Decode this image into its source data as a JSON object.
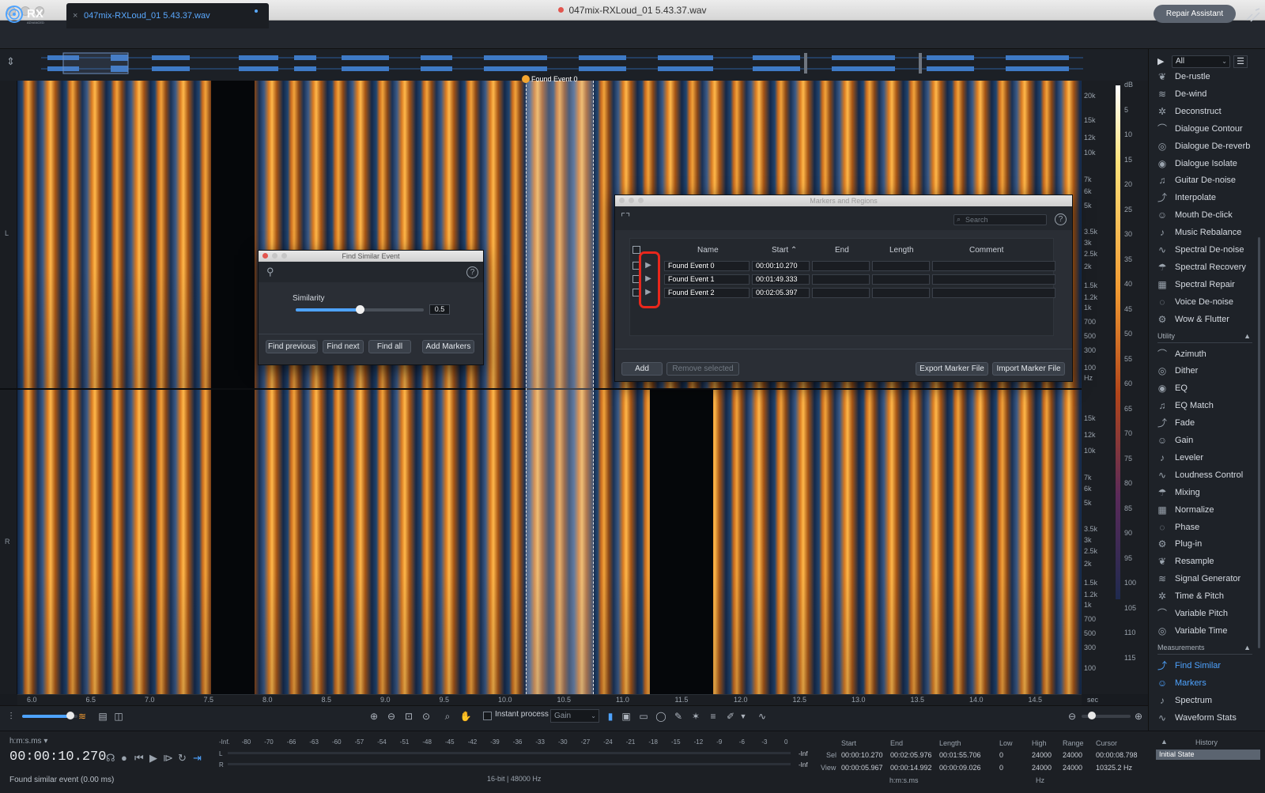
{
  "window": {
    "title": "047mix-RXLoud_01 5.43.37.wav"
  },
  "header": {
    "tab_label": "047mix-RXLoud_01 5.43.37.wav",
    "tab_close": "×",
    "repair_assistant": "Repair Assistant"
  },
  "spectrogram": {
    "marker_label": "Found Event 0",
    "channel_left": "L",
    "channel_right": "R",
    "freq_top": [
      "20k",
      "15k",
      "12k",
      "10k",
      "7k",
      "6k",
      "5k",
      "3.5k",
      "3k",
      "2.5k",
      "2k",
      "1.5k",
      "1.2k",
      "1k",
      "700",
      "500",
      "300",
      "100",
      "Hz"
    ],
    "freq_bot": [
      "20k",
      "15k",
      "12k",
      "10k",
      "7k",
      "6k",
      "5k",
      "3.5k",
      "3k",
      "2.5k",
      "2k",
      "1.5k",
      "1.2k",
      "1k",
      "700",
      "500",
      "300",
      "100"
    ],
    "db_scale": [
      "dB",
      "5",
      "10",
      "15",
      "20",
      "25",
      "30",
      "35",
      "40",
      "45",
      "50",
      "55",
      "60",
      "65",
      "70",
      "75",
      "80",
      "85",
      "90",
      "95",
      "100",
      "105",
      "110",
      "115"
    ],
    "time_ticks": [
      "6.0",
      "6.5",
      "7.0",
      "7.5",
      "8.0",
      "8.5",
      "9.0",
      "9.5",
      "10.0",
      "10.5",
      "11.0",
      "11.5",
      "12.0",
      "12.5",
      "13.0",
      "13.5",
      "14.0",
      "14.5",
      "sec"
    ]
  },
  "find_similar": {
    "title": "Find Similar Event",
    "similarity_label": "Similarity",
    "similarity_value": "0.5",
    "similarity_fraction": 0.5,
    "help": "?",
    "buttons": [
      "Find previous",
      "Find next",
      "Find all",
      "Add Markers"
    ]
  },
  "markers": {
    "title": "Markers and Regions",
    "search_placeholder": "Search",
    "help": "?",
    "columns": [
      "Name",
      "Start",
      "End",
      "Length",
      "Comment"
    ],
    "sort_indicator": "⌃",
    "rows": [
      {
        "name": "Found Event 0",
        "start": "00:00:10.270",
        "end": "",
        "length": "",
        "comment": ""
      },
      {
        "name": "Found Event 1",
        "start": "00:01:49.333",
        "end": "",
        "length": "",
        "comment": ""
      },
      {
        "name": "Found Event 2",
        "start": "00:02:05.397",
        "end": "",
        "length": "",
        "comment": ""
      }
    ],
    "buttons": {
      "add": "Add",
      "remove": "Remove selected",
      "export": "Export Marker File",
      "import": "Import Marker File"
    }
  },
  "sidebar": {
    "filter": "All",
    "repair_modules": [
      "De-rustle",
      "De-wind",
      "Deconstruct",
      "Dialogue Contour",
      "Dialogue De-reverb",
      "Dialogue Isolate",
      "Guitar De-noise",
      "Interpolate",
      "Mouth De-click",
      "Music Rebalance",
      "Spectral De-noise",
      "Spectral Recovery",
      "Spectral Repair",
      "Voice De-noise",
      "Wow & Flutter"
    ],
    "utility_label": "Utility",
    "utility_modules": [
      "Azimuth",
      "Dither",
      "EQ",
      "EQ Match",
      "Fade",
      "Gain",
      "Leveler",
      "Loudness Control",
      "Mixing",
      "Normalize",
      "Phase",
      "Plug-in",
      "Resample",
      "Signal Generator",
      "Time & Pitch",
      "Variable Pitch",
      "Variable Time"
    ],
    "measurements_label": "Measurements",
    "measurement_modules": [
      "Find Similar",
      "Markers",
      "Spectrum",
      "Waveform Stats"
    ],
    "active_modules": [
      "Find Similar",
      "Markers"
    ]
  },
  "toolbar": {
    "instant_process": "Instant process",
    "gain_option": "Gain"
  },
  "transport": {
    "format": "h:m:s.ms",
    "timecode": "00:00:10.270",
    "status": "Found similar event (0.00 ms)"
  },
  "meter": {
    "scale": [
      "-Inf.",
      "-80",
      "-70",
      "-66",
      "-63",
      "-60",
      "-57",
      "-54",
      "-51",
      "-48",
      "-45",
      "-42",
      "-39",
      "-36",
      "-33",
      "-30",
      "-27",
      "-24",
      "-21",
      "-18",
      "-15",
      "-12",
      "-9",
      "-6",
      "-3",
      "0"
    ],
    "left_label": "L",
    "right_label": "R",
    "left_peak": "-Inf",
    "right_peak": "-Inf",
    "bitrate": "16-bit | 48000 Hz"
  },
  "selection": {
    "headers": {
      "start": "Start",
      "end": "End",
      "length": "Length",
      "low": "Low",
      "high": "High",
      "range": "Range",
      "cursor": "Cursor"
    },
    "sel_label": "Sel",
    "view_label": "View",
    "sel": {
      "start": "00:00:10.270",
      "end": "00:02:05.976",
      "length": "00:01:55.706",
      "low": "0",
      "high": "24000",
      "range": "24000",
      "cursor": "00:00:08.798"
    },
    "view": {
      "start": "00:00:05.967",
      "end": "00:00:14.992",
      "length": "00:00:09.026",
      "low": "0",
      "high": "24000",
      "range": "24000",
      "cursor": "10325.2 Hz"
    },
    "time_unit": "h:m:s.ms",
    "freq_unit": "Hz"
  },
  "history": {
    "title": "History",
    "items": [
      "Initial State"
    ]
  }
}
